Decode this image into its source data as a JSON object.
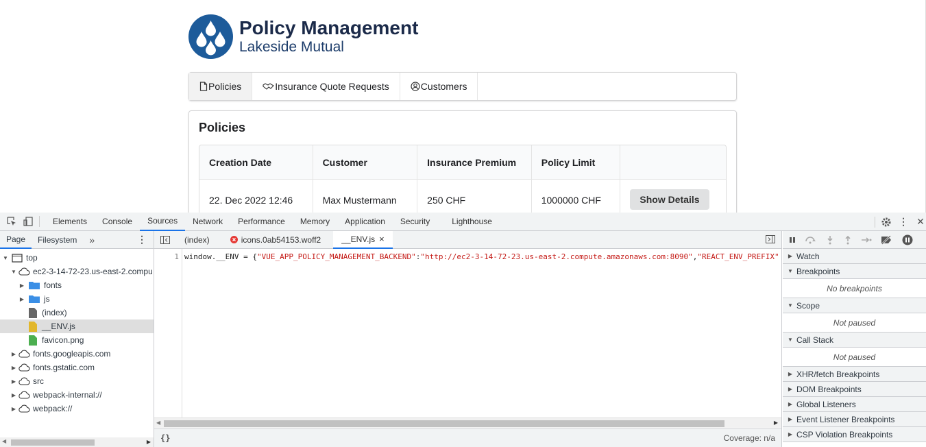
{
  "app": {
    "title": "Policy Management",
    "subtitle": "Lakeside Mutual",
    "menu": [
      {
        "label": "Policies",
        "icon": "file-icon",
        "active": true
      },
      {
        "label": "Insurance Quote Requests",
        "icon": "handshake-icon",
        "active": false
      },
      {
        "label": "Customers",
        "icon": "user-circle-icon",
        "active": false
      }
    ],
    "section_title": "Policies",
    "table": {
      "headers": [
        "Creation Date",
        "Customer",
        "Insurance Premium",
        "Policy Limit",
        ""
      ],
      "rows": [
        {
          "date": "22. Dec 2022 12:46",
          "customer": "Max Mustermann",
          "premium": "250 CHF",
          "limit": "1000000 CHF",
          "action": "Show Details"
        }
      ]
    },
    "colors": {
      "title": "#1b2a49",
      "logo": "#1d5b9a"
    }
  },
  "devtools": {
    "tabs": [
      "Elements",
      "Console",
      "Sources",
      "Network",
      "Performance",
      "Memory",
      "Application",
      "Security",
      "Lighthouse"
    ],
    "active_tab": "Sources",
    "navigator_tabs": [
      "Page",
      "Filesystem"
    ],
    "tree": [
      {
        "label": "top",
        "icon": "frame-icon",
        "depth": 0,
        "arrow": "▼"
      },
      {
        "label": "ec2-3-14-72-23.us-east-2.compu",
        "icon": "cloud-icon",
        "depth": 1,
        "arrow": "▼"
      },
      {
        "label": "fonts",
        "icon": "folder-icon",
        "depth": 2,
        "arrow": "▶"
      },
      {
        "label": "js",
        "icon": "folder-icon",
        "depth": 2,
        "arrow": "▶"
      },
      {
        "label": "(index)",
        "icon": "file-gray-icon",
        "depth": 2,
        "arrow": ""
      },
      {
        "label": "__ENV.js",
        "icon": "file-js-icon",
        "depth": 2,
        "arrow": "",
        "selected": true
      },
      {
        "label": "favicon.png",
        "icon": "file-image-icon",
        "depth": 2,
        "arrow": ""
      },
      {
        "label": "fonts.googleapis.com",
        "icon": "cloud-icon",
        "depth": 1,
        "arrow": "▶"
      },
      {
        "label": "fonts.gstatic.com",
        "icon": "cloud-icon",
        "depth": 1,
        "arrow": "▶"
      },
      {
        "label": "src",
        "icon": "cloud-icon",
        "depth": 1,
        "arrow": "▶"
      },
      {
        "label": "webpack-internal://",
        "icon": "cloud-icon",
        "depth": 1,
        "arrow": "▶"
      },
      {
        "label": "webpack://",
        "icon": "cloud-icon",
        "depth": 1,
        "arrow": "▶"
      }
    ],
    "editor_tabs": [
      {
        "label": "(index)",
        "error": false,
        "active": false
      },
      {
        "label": "icons.0ab54153.woff2",
        "error": true,
        "active": false
      },
      {
        "label": "__ENV.js",
        "error": false,
        "active": true,
        "close": "×"
      }
    ],
    "code": {
      "line_number": "1",
      "prefix": "window.__ENV = {",
      "key1": "\"VUE_APP_POLICY_MANAGEMENT_BACKEND\"",
      "colon1": ":",
      "val1": "\"http://ec2-3-14-72-23.us-east-2.compute.amazonaws.com:8090\"",
      "comma1": ",",
      "key2": "\"REACT_ENV_PREFIX\"",
      "colon2": ":"
    },
    "status": {
      "format": "{}",
      "coverage": "Coverage: n/a"
    },
    "debugger_sections": [
      {
        "label": "Watch",
        "info": ""
      },
      {
        "label": "Breakpoints",
        "info": "No breakpoints"
      },
      {
        "label": "Scope",
        "info": "Not paused"
      },
      {
        "label": "Call Stack",
        "info": "Not paused"
      },
      {
        "label": "XHR/fetch Breakpoints",
        "info": ""
      },
      {
        "label": "DOM Breakpoints",
        "info": ""
      },
      {
        "label": "Global Listeners",
        "info": ""
      },
      {
        "label": "Event Listener Breakpoints",
        "info": ""
      },
      {
        "label": "CSP Violation Breakpoints",
        "info": ""
      }
    ]
  }
}
